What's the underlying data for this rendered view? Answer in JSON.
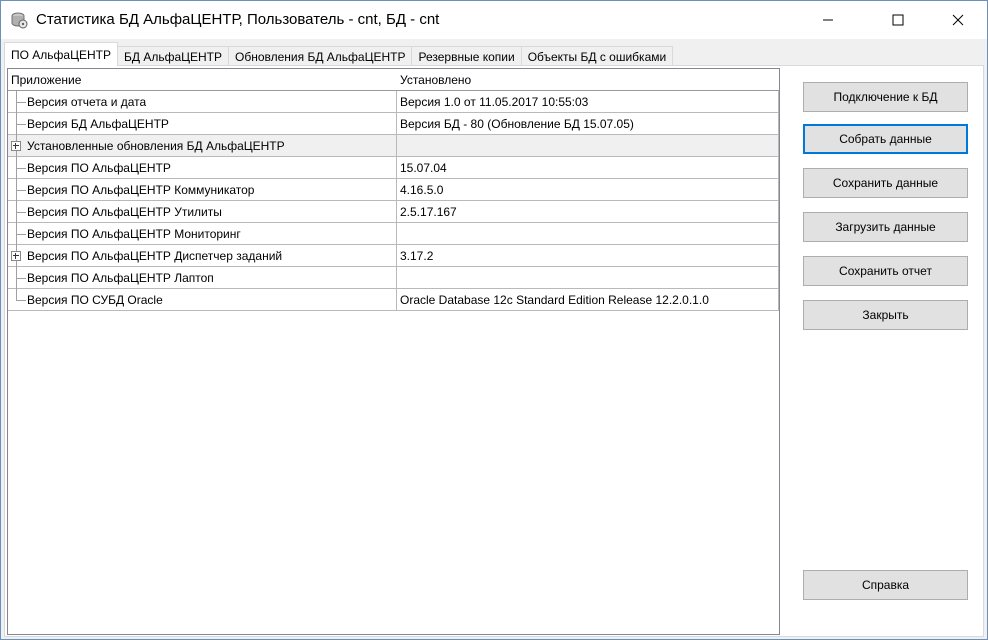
{
  "window": {
    "title": "Статистика БД АльфаЦЕНТР, Пользователь - cnt, БД - cnt"
  },
  "tabs": [
    {
      "label": "ПО АльфаЦЕНТР",
      "active": true
    },
    {
      "label": "БД АльфаЦЕНТР",
      "active": false
    },
    {
      "label": "Обновления БД АльфаЦЕНТР",
      "active": false
    },
    {
      "label": "Резервные копии",
      "active": false
    },
    {
      "label": "Объекты БД с ошибками",
      "active": false
    }
  ],
  "grid": {
    "columns": [
      "Приложение",
      "Установлено"
    ],
    "rows": [
      {
        "name": "Версия отчета и дата",
        "value": "Версия 1.0 от 11.05.2017 10:55:03",
        "expandable": false
      },
      {
        "name": "Версия БД АльфаЦЕНТР",
        "value": "Версия БД - 80 (Обновление БД 15.07.05)",
        "expandable": false
      },
      {
        "name": "Установленные обновления БД АльфаЦЕНТР",
        "value": "",
        "expandable": true
      },
      {
        "name": "Версия ПО АльфаЦЕНТР",
        "value": "15.07.04",
        "expandable": false
      },
      {
        "name": "Версия ПО АльфаЦЕНТР Коммуникатор",
        "value": "4.16.5.0",
        "expandable": false
      },
      {
        "name": "Версия ПО АльфаЦЕНТР Утилиты",
        "value": "2.5.17.167",
        "expandable": false
      },
      {
        "name": "Версия ПО АльфаЦЕНТР Мониторинг",
        "value": "",
        "expandable": false
      },
      {
        "name": "Версия ПО АльфаЦЕНТР Диспетчер заданий",
        "value": "3.17.2",
        "expandable": true
      },
      {
        "name": "Версия ПО АльфаЦЕНТР Лаптоп",
        "value": "",
        "expandable": false
      },
      {
        "name": "Версия ПО СУБД Oracle",
        "value": "Oracle Database 12c Standard Edition Release 12.2.0.1.0",
        "expandable": false
      }
    ]
  },
  "buttons": {
    "connect": "Подключение к БД",
    "collect": "Собрать данные",
    "save_data": "Сохранить данные",
    "load_data": "Загрузить данные",
    "save_report": "Сохранить отчет",
    "close": "Закрыть",
    "help": "Справка"
  },
  "icons": {
    "app": "database-disk-icon",
    "minimize": "minimize-icon",
    "maximize": "maximize-icon",
    "close": "close-icon",
    "expander": "plus-box-icon"
  },
  "colors": {
    "focus_border": "#0078d7",
    "button_face": "#e1e1e1",
    "alt_row": "#f0f0f0"
  }
}
